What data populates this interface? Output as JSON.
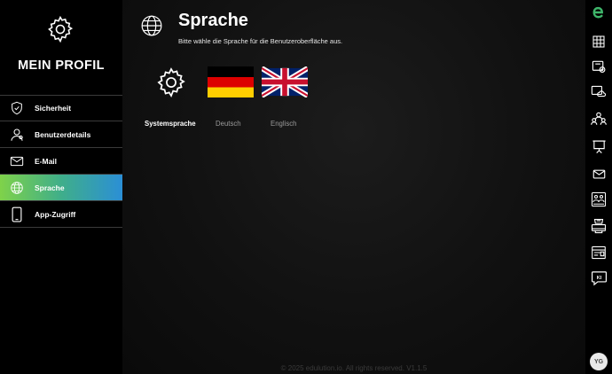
{
  "sidebar": {
    "title": "MEIN PROFIL",
    "items": [
      {
        "label": "Sicherheit",
        "icon": "shield-check-icon"
      },
      {
        "label": "Benutzerdetails",
        "icon": "user-details-icon"
      },
      {
        "label": "E-Mail",
        "icon": "mail-icon"
      },
      {
        "label": "Sprache",
        "icon": "globe-icon",
        "active": true
      },
      {
        "label": "App-Zugriff",
        "icon": "tablet-icon"
      }
    ]
  },
  "main": {
    "title": "Sprache",
    "subtitle": "Bitte wähle die Sprache für die Benutzeroberfläche aus.",
    "languages": [
      {
        "label": "Systemsprache",
        "icon": "gear-icon",
        "selected": true
      },
      {
        "label": "Deutsch",
        "icon": "german-flag-icon",
        "selected": false
      },
      {
        "label": "Englisch",
        "icon": "uk-flag-icon",
        "selected": false
      }
    ],
    "footer": "© 2025 edulution.io. All rights reserved. V1.1.5"
  },
  "rightbar": {
    "icons": [
      "edulution-logo-icon",
      "grid-icon",
      "files-icon",
      "cloud-icon",
      "users-icon",
      "presentation-icon",
      "mail-icon",
      "classroom-icon",
      "printer-icon",
      "browser-icon",
      "ai-chat-icon"
    ],
    "avatar_initials": "YG",
    "ai_badge": "KI"
  },
  "colors": {
    "active_gradient_start": "#7fd24a",
    "active_gradient_end": "#2b8fd6",
    "logo_green": "#3fb56a",
    "background": "#0a0a0a"
  }
}
